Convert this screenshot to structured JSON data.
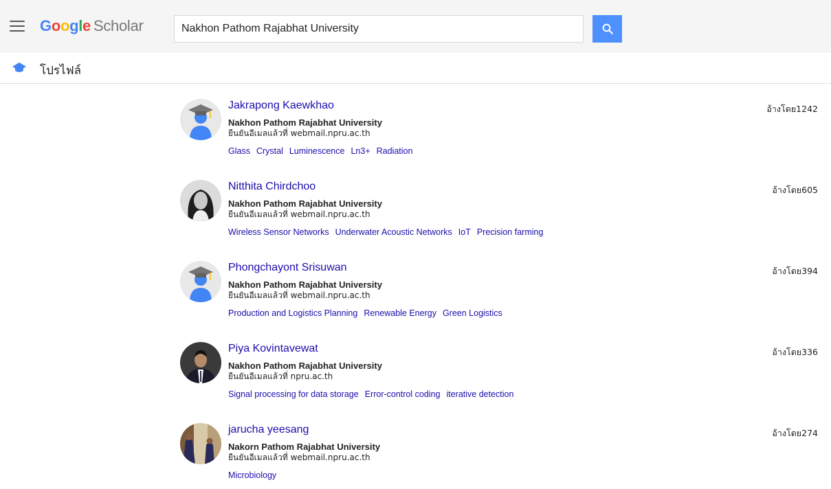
{
  "header": {
    "menu_icon": "hamburger-menu-icon",
    "logo_brand": "Google",
    "logo_product": "Scholar",
    "search_value": "Nakhon Pathom Rajabhat University",
    "search_icon": "search-icon",
    "accent_color": "#4d90fe"
  },
  "subnav": {
    "icon": "graduation-cap-icon",
    "title": "โปรไฟล์"
  },
  "results": [
    {
      "name": "Jakrapong Kaewkhao",
      "affiliation": "Nakhon Pathom Rajabhat University",
      "email": "ยืนยันอีเมลแล้วที่ webmail.npru.ac.th",
      "tags": [
        "Glass",
        "Crystal",
        "Luminescence",
        "Ln3+",
        "Radiation"
      ],
      "cited": "อ้างโดย1242",
      "avatar": "default-avatar"
    },
    {
      "name": "Nitthita Chirdchoo",
      "affiliation": "Nakhon Pathom Rajabhat University",
      "email": "ยืนยันอีเมลแล้วที่ webmail.npru.ac.th",
      "tags": [
        "Wireless Sensor Networks",
        "Underwater Acoustic Networks",
        "IoT",
        "Precision farming"
      ],
      "cited": "อ้างโดย605",
      "avatar": "photo"
    },
    {
      "name": "Phongchayont Srisuwan",
      "affiliation": "Nakhon Pathom Rajabhat University",
      "email": "ยืนยันอีเมลแล้วที่ webmail.npru.ac.th",
      "tags": [
        "Production and Logistics Planning",
        "Renewable Energy",
        "Green Logistics"
      ],
      "cited": "อ้างโดย394",
      "avatar": "default-avatar"
    },
    {
      "name": "Piya Kovintavewat",
      "affiliation": "Nakhon Pathom Rajabhat University",
      "email": "ยืนยันอีเมลแล้วที่ npru.ac.th",
      "tags": [
        "Signal processing for data storage",
        "Error-control coding",
        "iterative detection"
      ],
      "cited": "อ้างโดย336",
      "avatar": "photo"
    },
    {
      "name": "jarucha yeesang",
      "affiliation": "Nakorn Pathom Rajabhat University",
      "email": "ยืนยันอีเมลแล้วที่ webmail.npru.ac.th",
      "tags": [
        "Microbiology"
      ],
      "cited": "อ้างโดย274",
      "avatar": "photo"
    }
  ]
}
